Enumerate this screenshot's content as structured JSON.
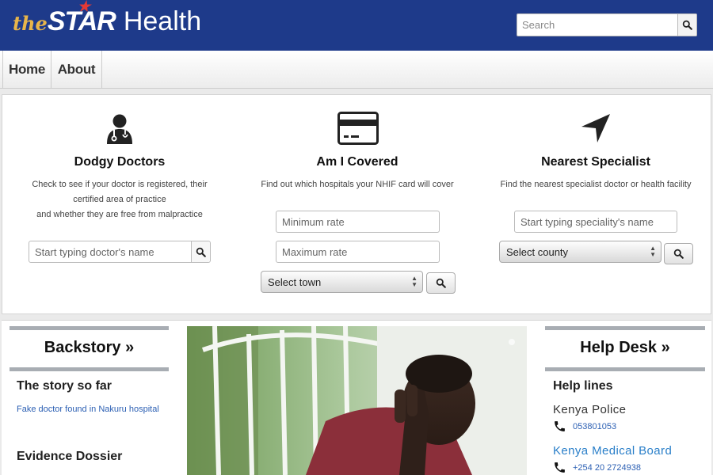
{
  "header": {
    "logo": {
      "the": "the",
      "star": "STAR",
      "health": "Health"
    },
    "search": {
      "placeholder": "Search",
      "icon": "search-icon"
    }
  },
  "nav": {
    "items": [
      {
        "label": "Home"
      },
      {
        "label": "About"
      }
    ]
  },
  "tools": [
    {
      "icon": "doctor-icon",
      "title": "Dodgy Doctors",
      "desc_lines": [
        "Check to see if your doctor is registered, their",
        "certified area of practice",
        "and whether they are free from malpractice"
      ],
      "input_placeholder": "Start typing doctor's name"
    },
    {
      "icon": "credit-card-icon",
      "title": "Am I Covered",
      "desc": "Find out which hospitals your NHIF card will cover",
      "min_placeholder": "Minimum rate",
      "max_placeholder": "Maximum rate",
      "select_value": "Select town"
    },
    {
      "icon": "location-arrow-icon",
      "title": "Nearest Specialist",
      "desc": "Find the nearest specialist doctor or health facility",
      "input_placeholder": "Start typing speciality's name",
      "select_value": "Select county"
    }
  ],
  "backstory": {
    "heading": "Backstory »",
    "sections": [
      {
        "title": "The story so far",
        "link": "Fake doctor found in Nakuru hospital"
      },
      {
        "title": "Evidence Dossier"
      }
    ]
  },
  "helpdesk": {
    "heading": "Help Desk »",
    "subheading": "Help lines",
    "contacts": [
      {
        "name": "Kenya Police",
        "phone": "053801053"
      },
      {
        "name": "Kenya Medical Board",
        "phone": "+254 20 2724938"
      }
    ]
  },
  "colors": {
    "header_bg": "#1e3a8a",
    "link": "#2b5fb3",
    "accent_blue": "#2a7fc9",
    "logo_gold": "#e8b54a",
    "star_red": "#e53935"
  }
}
